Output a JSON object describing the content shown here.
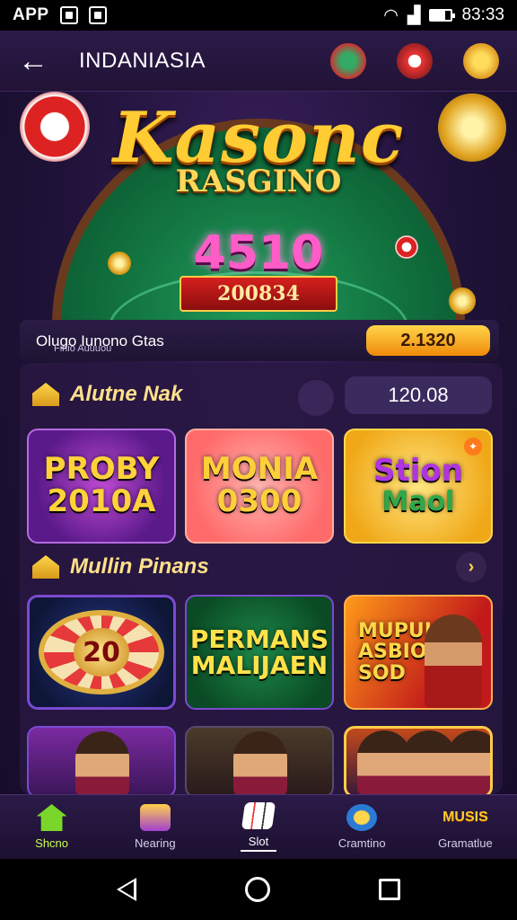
{
  "status_bar": {
    "app_label": "APP",
    "time": "83:33"
  },
  "header": {
    "title": "INDANIASIA",
    "back_icon": "arrow-left-icon"
  },
  "hero": {
    "title": "Kasonc",
    "subtitle": "RASGINO",
    "amount": "4510",
    "ribbon": "200834"
  },
  "winbar": {
    "line1": "Olugo Iunono Gtas",
    "line2": "Finio Auuuou",
    "value": "2.1320"
  },
  "section1": {
    "title": "Alutne Nak",
    "balance": "120.08"
  },
  "games_row1": [
    {
      "line1": "PROBY",
      "line2": "2010A"
    },
    {
      "line1": "MONIA",
      "line2": "0300"
    },
    {
      "line1": "Stion",
      "line2": "Maol"
    }
  ],
  "section2": {
    "title": "Mullin Pinans",
    "more": "›"
  },
  "games_row2": [
    {
      "label": "20"
    },
    {
      "line1": "PERMANS",
      "line2": "MALIJAEN"
    },
    {
      "line1": "MUPUIS",
      "line2": "ASBIOK",
      "line3": "SOD"
    }
  ],
  "bottom_nav": [
    {
      "label": "Shcno",
      "icon": "home-icon",
      "active": true
    },
    {
      "label": "Nearing",
      "icon": "vip-icon"
    },
    {
      "label": "Slot",
      "icon": "cards-icon"
    },
    {
      "label": "Cramtino",
      "icon": "promo-icon"
    },
    {
      "label": "Gramatlue",
      "icon": "logo-icon",
      "logo_text": "MUSIS"
    }
  ],
  "colors": {
    "accent": "#ffd24a",
    "active_nav": "#c6ff4a",
    "background": "#1f1238"
  }
}
